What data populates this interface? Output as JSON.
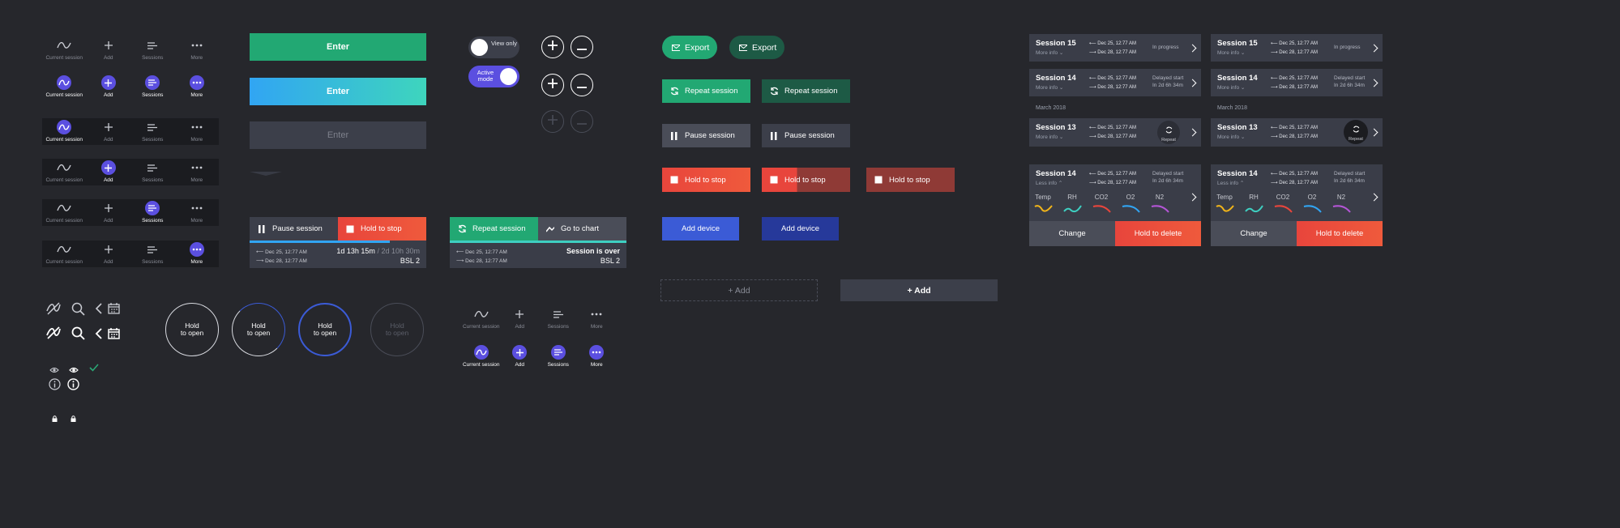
{
  "nav": {
    "current": "Current session",
    "add": "Add",
    "sessions": "Sessions",
    "more": "More"
  },
  "enter": {
    "label": "Enter"
  },
  "toggles": {
    "view_only": "View only",
    "active_mode": "Active mode"
  },
  "export": {
    "label": "Export"
  },
  "repeat_session": {
    "label": "Repeat session"
  },
  "pause_session": {
    "label": "Pause session"
  },
  "hold_to_stop": {
    "label": "Hold to stop"
  },
  "add_device": {
    "label": "Add device"
  },
  "add": {
    "label": "+ Add"
  },
  "go_to_chart": {
    "label": "Go to chart"
  },
  "hold_to_open": {
    "line1": "Hold",
    "line2": "to open"
  },
  "session_panel": {
    "date_start": "Dec 25, 12:77 AM",
    "date_end": "Dec 28, 12:77 AM",
    "elapsed": "1d 13h 15m",
    "total": "/ 2d 10h 30m",
    "bsl": "BSL 2",
    "over": "Session is over"
  },
  "cards": {
    "s15": "Session 15",
    "s14": "Session 14",
    "s13": "Session 13",
    "more_info": "More info",
    "less_info": "Less info",
    "in_progress": "In progress",
    "delayed_start": "Delayed start",
    "delayed_in": "In 2d 6h 34m",
    "month": "March 2018",
    "repeat": "Repeat",
    "date_start": "Dec 25, 12:77 AM",
    "date_end": "Dec 28, 12:77 AM",
    "params": [
      "Temp",
      "RH",
      "CO2",
      "O2",
      "N2"
    ],
    "change": "Change",
    "hold_to_delete": "Hold to delete"
  },
  "colors": {
    "green": "#2aa876",
    "red": "#e8453c",
    "blue": "#3b5bd6",
    "purple": "#5b4fe0",
    "teal": "#3ecfc1"
  }
}
